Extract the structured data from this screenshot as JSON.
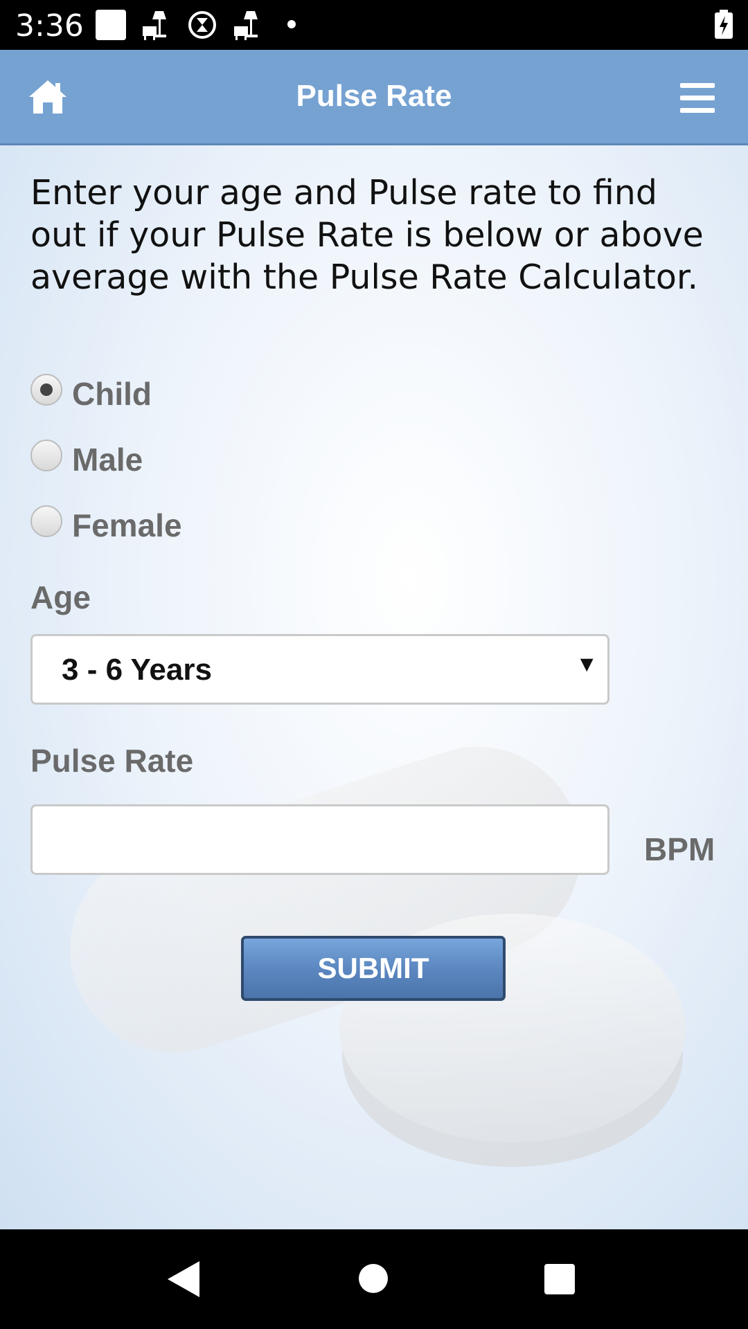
{
  "status_bar": {
    "time": "3:36",
    "icons": [
      "square-notification-icon",
      "furniture-icon",
      "hourglass-icon",
      "furniture-icon",
      "dot-icon",
      "battery-charging-icon"
    ]
  },
  "app_bar": {
    "title": "Pulse Rate",
    "home_icon": "home-icon",
    "menu_icon": "hamburger-menu-icon"
  },
  "intro_text": "Enter your age and Pulse rate to find out if your Pulse Rate is below or above average with the Pulse Rate Calculator.",
  "gender": {
    "options": [
      {
        "label": "Child",
        "selected": true
      },
      {
        "label": "Male",
        "selected": false
      },
      {
        "label": "Female",
        "selected": false
      }
    ]
  },
  "age": {
    "label": "Age",
    "selected_value": "3 - 6 Years"
  },
  "pulse_rate": {
    "label": "Pulse Rate",
    "value": "",
    "unit": "BPM"
  },
  "submit_label": "SUBMIT",
  "colors": {
    "app_bar": "#76a2d2",
    "button": "#5c87c0",
    "label_gray": "#6a6a6a"
  }
}
